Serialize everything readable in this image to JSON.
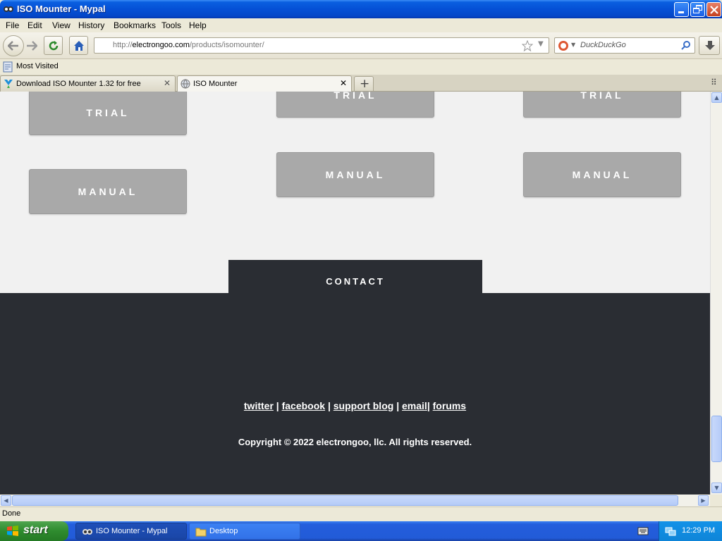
{
  "window": {
    "title": "ISO Mounter - Mypal"
  },
  "menu": [
    "File",
    "Edit",
    "View",
    "History",
    "Bookmarks",
    "Tools",
    "Help"
  ],
  "navbar": {
    "url_prefix": "http://",
    "url_domain": "electrongoo.com",
    "url_path": "/products/isomounter/",
    "search_placeholder": "DuckDuckGo"
  },
  "bookmarks": {
    "most_visited": "Most Visited"
  },
  "tabs": [
    {
      "label": "Download ISO Mounter 1.32 for free"
    },
    {
      "label": "ISO Mounter"
    }
  ],
  "page": {
    "buttons": {
      "trial": "TRIAL",
      "manual": "MANUAL"
    },
    "contact": "CONTACT",
    "footer_links": [
      "twitter",
      "facebook",
      "support blog",
      "email",
      "forums"
    ],
    "copyright": "Copyright © 2022 electrongoo, llc. All rights reserved."
  },
  "status": {
    "text": "Done"
  },
  "taskbar": {
    "start": "start",
    "items": [
      "ISO Mounter - Mypal",
      "Desktop"
    ],
    "clock": "12:29 PM"
  }
}
